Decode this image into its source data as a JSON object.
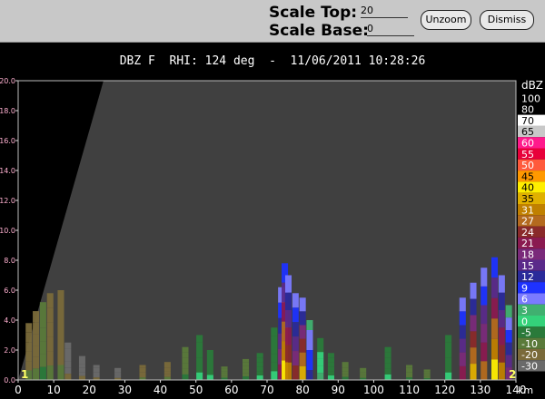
{
  "toolbar": {
    "scale_top_label": "Scale Top:",
    "scale_top_value": "20",
    "scale_base_label": "Scale Base:",
    "scale_base_value": "0",
    "unzoom_label": "Unzoom",
    "dismiss_label": "Dismiss"
  },
  "plot": {
    "title": "DBZ F  RHI: 124 deg  -  11/06/2011 10:28:26",
    "background_color": "#404040",
    "blocked_color": "#000000",
    "corner_markers": [
      "1",
      "2"
    ],
    "marker_color": "#ffff66"
  },
  "chart_data": {
    "type": "heatmap",
    "title": "DBZ F  RHI: 124 deg  -  11/06/2011 10:28:26",
    "xlabel": "",
    "x_unit": "km",
    "ylabel": "",
    "xlim": [
      0,
      140
    ],
    "ylim": [
      0,
      20
    ],
    "x_ticks": [
      "0",
      "10",
      "20",
      "30",
      "40",
      "50",
      "60",
      "70",
      "80",
      "90",
      "100",
      "110",
      "120",
      "130",
      "140"
    ],
    "y_ticks": [
      "0.0",
      "2.0",
      "4.0",
      "6.0",
      "8.0",
      "10.0",
      "12.0",
      "14.0",
      "16.0",
      "18.0",
      "20.0"
    ],
    "colorbar": {
      "unit": "dBZ",
      "levels": [
        {
          "label": "100",
          "color": "#000000"
        },
        {
          "label": "80",
          "color": "#000000"
        },
        {
          "label": "70",
          "color": "#ffffff"
        },
        {
          "label": "65",
          "color": "#c8c8c8"
        },
        {
          "label": "60",
          "color": "#ff1a8c"
        },
        {
          "label": "55",
          "color": "#e8003a"
        },
        {
          "label": "50",
          "color": "#ff5a3c"
        },
        {
          "label": "45",
          "color": "#ff9900"
        },
        {
          "label": "40",
          "color": "#ffee00"
        },
        {
          "label": "35",
          "color": "#e0b000"
        },
        {
          "label": "31",
          "color": "#c08000"
        },
        {
          "label": "27",
          "color": "#b46a1e"
        },
        {
          "label": "24",
          "color": "#8a2a2a"
        },
        {
          "label": "21",
          "color": "#8a1a50"
        },
        {
          "label": "18",
          "color": "#7a2a7a"
        },
        {
          "label": "15",
          "color": "#5a2a8a"
        },
        {
          "label": "12",
          "color": "#2a2a9a"
        },
        {
          "label": "9",
          "color": "#1e32ff"
        },
        {
          "label": "6",
          "color": "#7a7aff"
        },
        {
          "label": "3",
          "color": "#40b070"
        },
        {
          "label": "0",
          "color": "#34d27a"
        },
        {
          "label": "-5",
          "color": "#2a7a3a"
        },
        {
          "label": "-10",
          "color": "#5a7a3a"
        },
        {
          "label": "-20",
          "color": "#7a6a3a"
        },
        {
          "label": "-30",
          "color": "#6a6a6a"
        }
      ]
    },
    "blocked_sector": {
      "x_at_top": 24,
      "x_at_zero": 0
    },
    "echo_cells": [
      {
        "x": 3,
        "z_top": 3.8,
        "dbz": -10
      },
      {
        "x": 5,
        "z_top": 4.6,
        "dbz": -10
      },
      {
        "x": 7,
        "z_top": 5.2,
        "dbz": -5
      },
      {
        "x": 9,
        "z_top": 5.8,
        "dbz": -10
      },
      {
        "x": 12,
        "z_top": 6.0,
        "dbz": -10
      },
      {
        "x": 14,
        "z_top": 2.5,
        "dbz": -20
      },
      {
        "x": 18,
        "z_top": 1.6,
        "dbz": -20
      },
      {
        "x": 22,
        "z_top": 1.0,
        "dbz": -20
      },
      {
        "x": 28,
        "z_top": 0.8,
        "dbz": -20
      },
      {
        "x": 35,
        "z_top": 1.0,
        "dbz": -10
      },
      {
        "x": 42,
        "z_top": 1.2,
        "dbz": -10
      },
      {
        "x": 47,
        "z_top": 2.2,
        "dbz": -5
      },
      {
        "x": 51,
        "z_top": 3.0,
        "dbz": 0
      },
      {
        "x": 54,
        "z_top": 2.0,
        "dbz": 0
      },
      {
        "x": 58,
        "z_top": 0.9,
        "dbz": -5
      },
      {
        "x": 64,
        "z_top": 1.4,
        "dbz": -5
      },
      {
        "x": 68,
        "z_top": 1.8,
        "dbz": 0
      },
      {
        "x": 72,
        "z_top": 3.5,
        "dbz": 0
      },
      {
        "x": 74,
        "z_top": 6.2,
        "dbz": 21
      },
      {
        "x": 75,
        "z_top": 7.8,
        "dbz": 40
      },
      {
        "x": 76,
        "z_top": 7.0,
        "dbz": 31
      },
      {
        "x": 78,
        "z_top": 5.8,
        "dbz": 24
      },
      {
        "x": 80,
        "z_top": 5.5,
        "dbz": 35
      },
      {
        "x": 82,
        "z_top": 4.0,
        "dbz": 12
      },
      {
        "x": 85,
        "z_top": 2.8,
        "dbz": 3
      },
      {
        "x": 88,
        "z_top": 1.8,
        "dbz": 0
      },
      {
        "x": 92,
        "z_top": 1.2,
        "dbz": -5
      },
      {
        "x": 97,
        "z_top": 0.8,
        "dbz": -5
      },
      {
        "x": 104,
        "z_top": 2.2,
        "dbz": 0
      },
      {
        "x": 110,
        "z_top": 1.0,
        "dbz": -5
      },
      {
        "x": 115,
        "z_top": 0.7,
        "dbz": -5
      },
      {
        "x": 121,
        "z_top": 3.0,
        "dbz": 0
      },
      {
        "x": 125,
        "z_top": 5.5,
        "dbz": 21
      },
      {
        "x": 128,
        "z_top": 6.5,
        "dbz": 35
      },
      {
        "x": 131,
        "z_top": 7.5,
        "dbz": 27
      },
      {
        "x": 134,
        "z_top": 8.2,
        "dbz": 40
      },
      {
        "x": 136,
        "z_top": 7.0,
        "dbz": 31
      },
      {
        "x": 138,
        "z_top": 5.0,
        "dbz": 18
      }
    ]
  }
}
